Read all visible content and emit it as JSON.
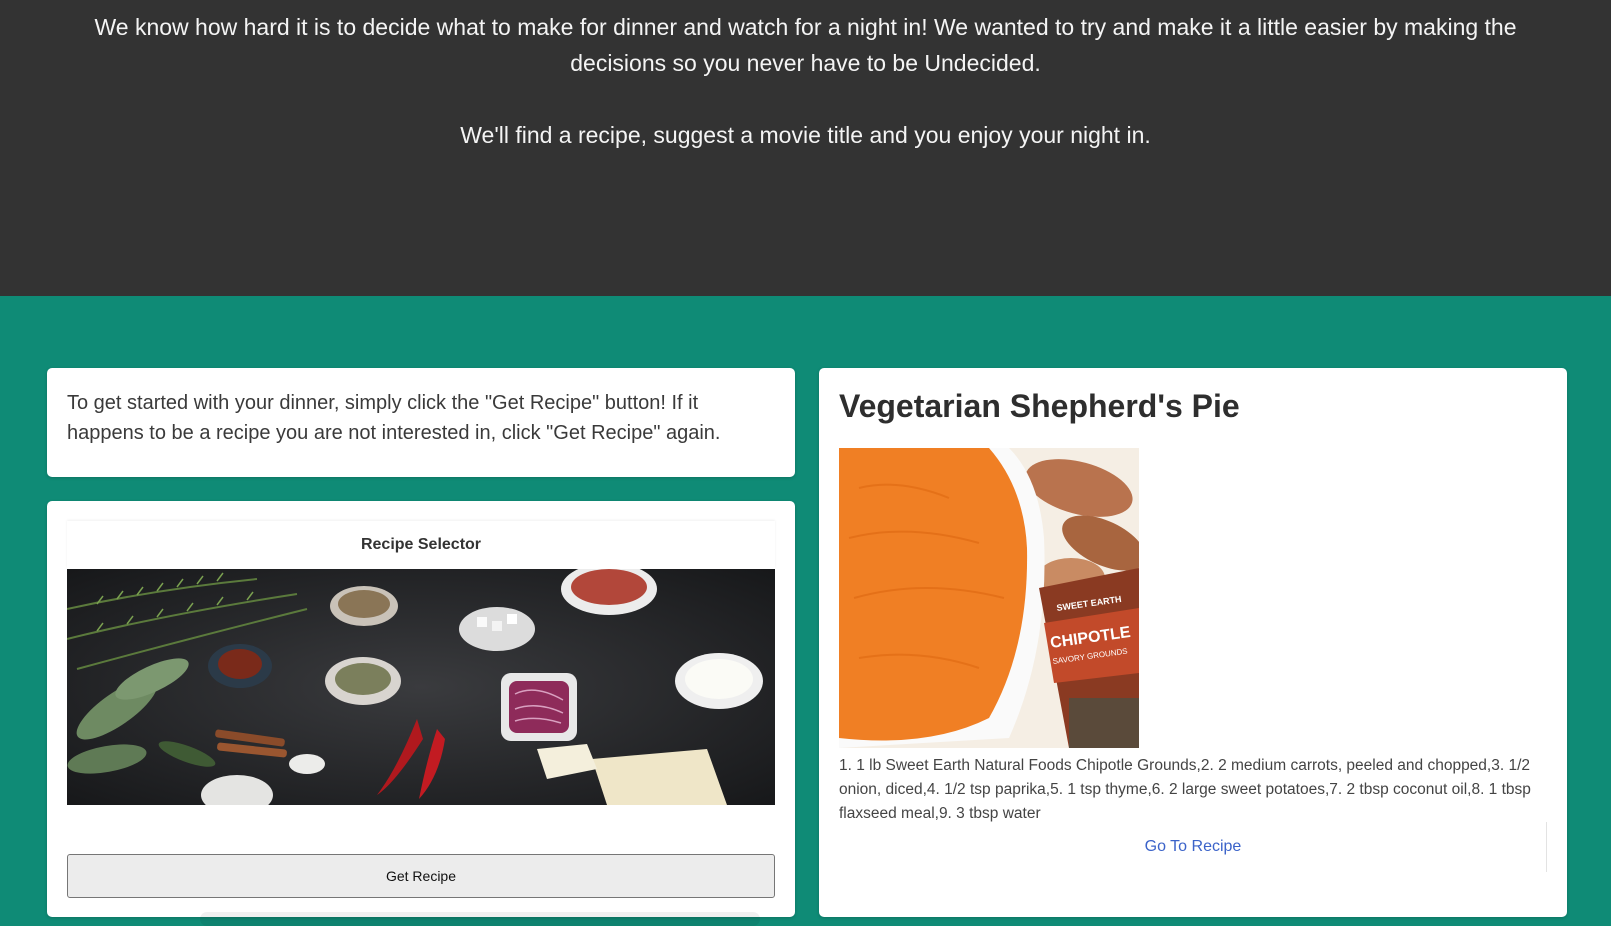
{
  "hero": {
    "intro_text": "We know how hard it is to decide what to make for dinner and watch for a night in! We wanted to try and make it a little easier by making the decisions so you never have to be Undecided.",
    "tagline": "We'll find a recipe, suggest a movie title and you enjoy your night in."
  },
  "instructions": {
    "text": "To get started with your dinner, simply click the \"Get Recipe\" button! If it happens to be a recipe you are not interested in, click \"Get Recipe\" again."
  },
  "selector": {
    "title": "Recipe Selector",
    "button_label": "Get Recipe"
  },
  "recipe": {
    "title": "Vegetarian Shepherd's Pie",
    "ingredients": "1. 1 lb Sweet Earth Natural Foods Chipotle Grounds,2. 2 medium carrots, peeled and chopped,3. 1/2 onion, diced,4. 1/2 tsp paprika,5. 1 tsp thyme,6. 2 large sweet potatoes,7. 2 tbsp coconut oil,8. 1 tbsp flaxseed meal,9. 3 tbsp water",
    "link_label": "Go To Recipe",
    "package_brand": "SWEET EARTH",
    "package_product": "CHIPOTLE",
    "package_sub": "SAVORY GROUNDS"
  },
  "colors": {
    "hero_bg": "#333333",
    "page_bg": "#0f8b76",
    "card_bg": "#ffffff",
    "link": "#3b63c9"
  }
}
